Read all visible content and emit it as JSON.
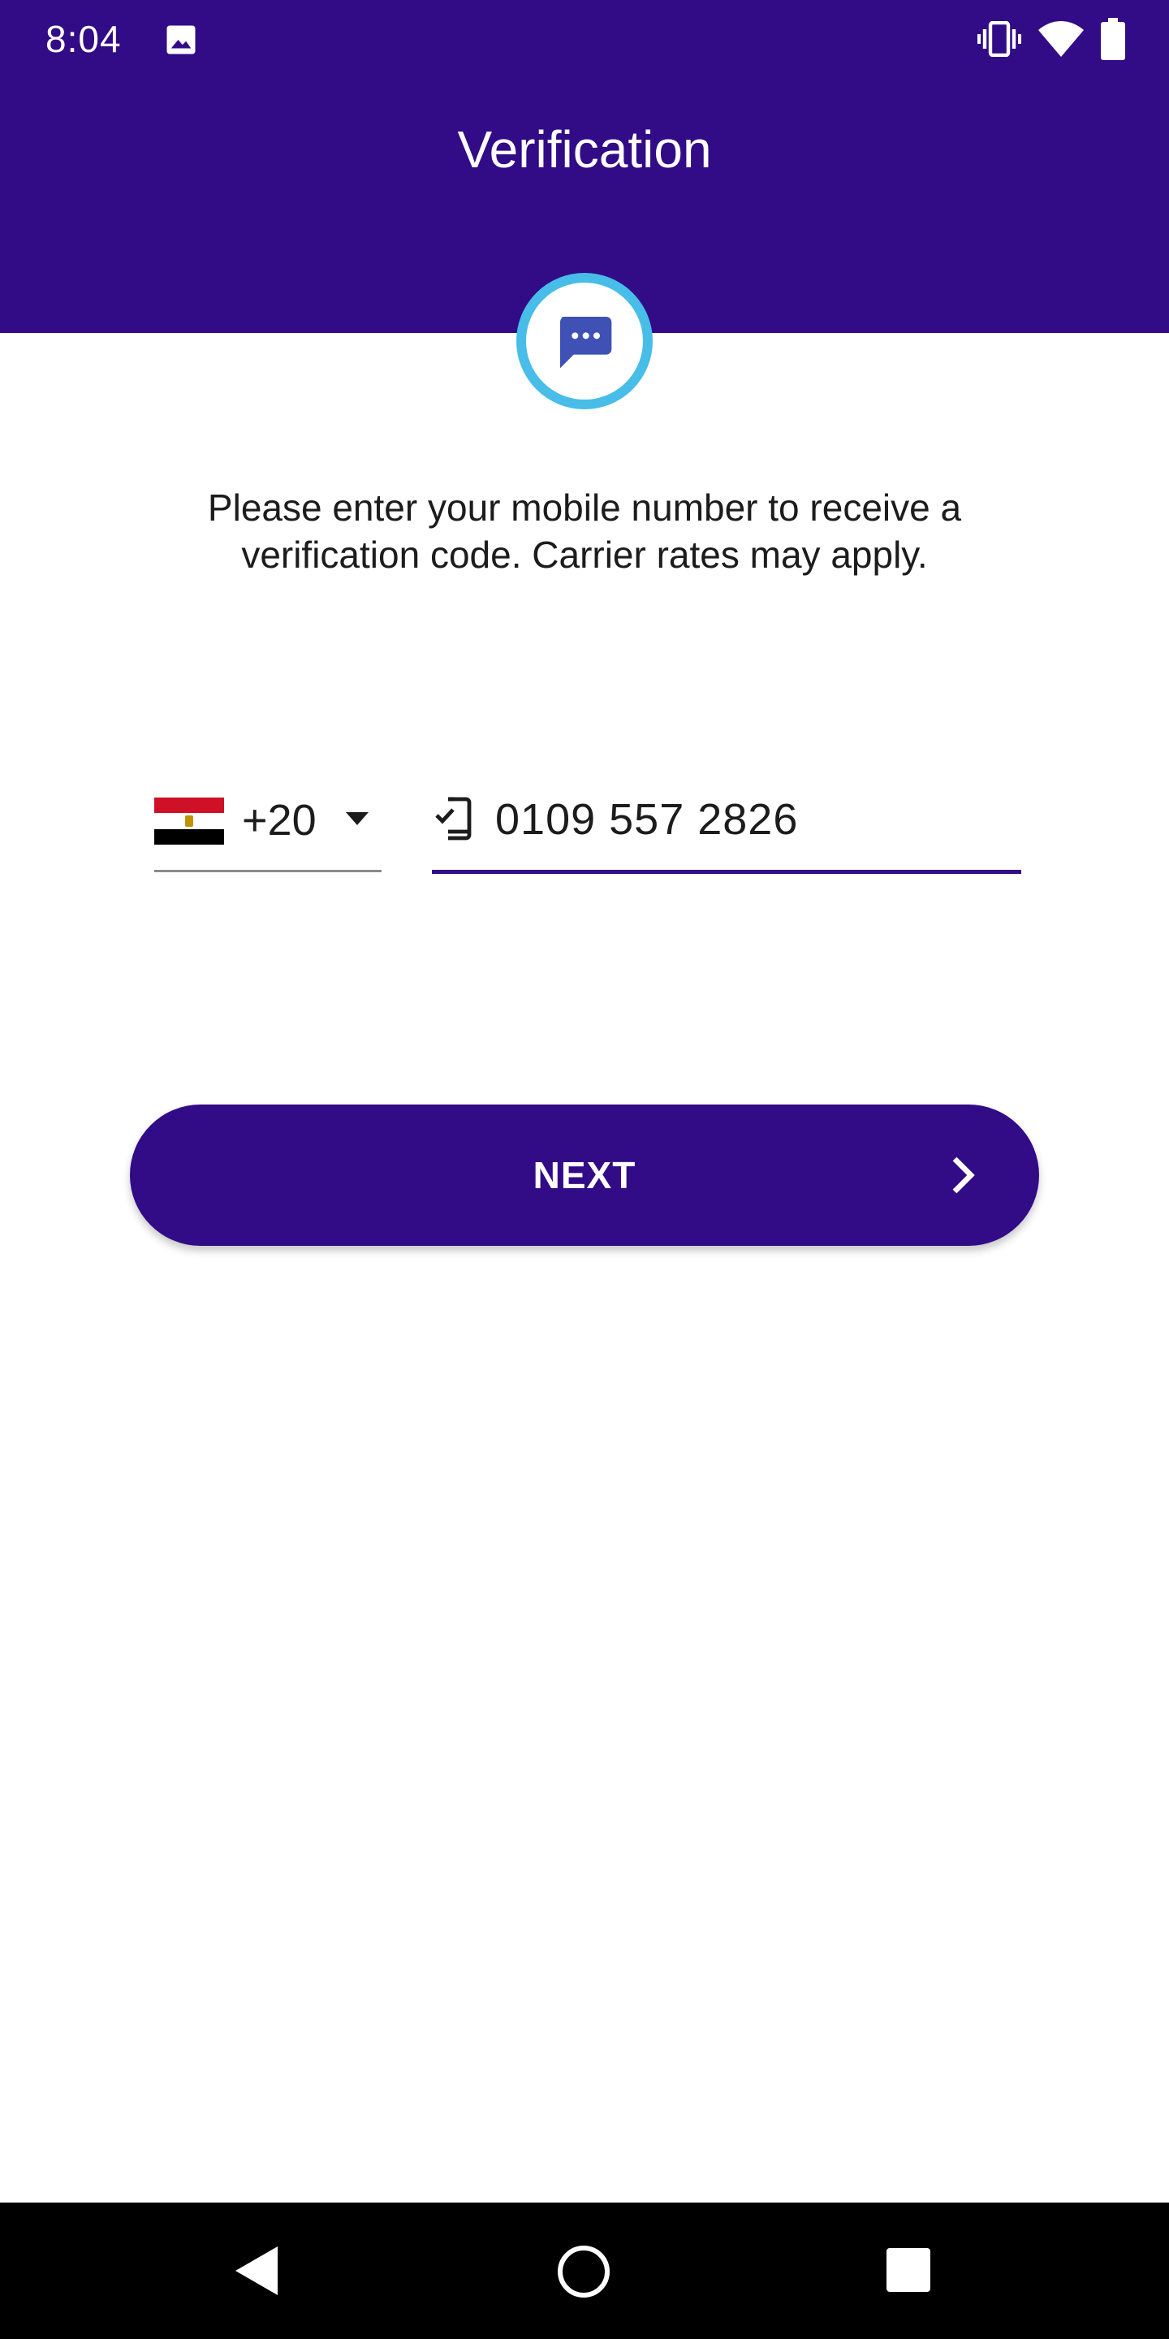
{
  "status_bar": {
    "time": "8:04",
    "icons": [
      "gallery-icon",
      "vibrate-icon",
      "wifi-icon",
      "battery-icon"
    ]
  },
  "header": {
    "title": "Verification",
    "background_color": "#320b86"
  },
  "badge": {
    "icon": "chat-bubble-icon",
    "ring_color": "#47bde8",
    "icon_color": "#3f51b5"
  },
  "instructions": "Please enter your mobile number to receive a verification code. Carrier rates may apply.",
  "country_picker": {
    "flag": "egypt-flag-icon",
    "code": "+20"
  },
  "phone_field": {
    "icon": "phone-verified-icon",
    "value": "0109 557 2826"
  },
  "next_button": {
    "label": "NEXT",
    "icon": "chevron-right-icon"
  },
  "nav_bar": {
    "icons": [
      "back-icon",
      "home-icon",
      "recents-icon"
    ]
  }
}
